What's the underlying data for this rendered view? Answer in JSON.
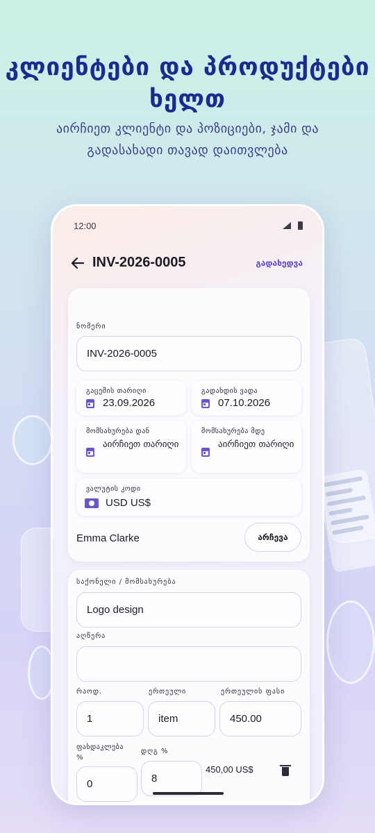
{
  "hero": {
    "title": "კლიენტები და პროდუქტები ხელთ",
    "subtitle": "აირჩიეთ კლიენტი და პოზიციები, ჯამი და გადასახადი თავად დაითვლება"
  },
  "status_bar": {
    "time": "12:00"
  },
  "header": {
    "title": "INV-2026-0005",
    "preview_label": "გადახედვა"
  },
  "invoice": {
    "number_label": "ნომერი",
    "number_value": "INV-2026-0005",
    "issue_date_label": "გაცემის თარიღი",
    "issue_date_value": "23.09.2026",
    "due_date_label": "გადახდის ვადა",
    "due_date_value": "07.10.2026",
    "service_from_label": "მომსახურება დან",
    "service_from_value": "აირჩიეთ თარიღი",
    "service_to_label": "მომსახურება მდე",
    "service_to_value": "აირჩიეთ თარიღი",
    "currency_label": "ვალუტის კოდი",
    "currency_value": "USD  US$",
    "client_name": "Emma Clarke",
    "choose_client_label": "არჩევა"
  },
  "line_item": {
    "product_label": "საქონელი / მომსახურება",
    "product_value": "Logo design",
    "description_label": "აღწერა",
    "description_value": "",
    "qty_label": "რაოდ.",
    "qty_value": "1",
    "unit_label": "ერთეული",
    "unit_value": "item",
    "unit_price_label": "ერთეულის ფასი",
    "unit_price_value": "450.00",
    "discount_label": "ფასდაკლება %",
    "discount_value": "0",
    "vat_label": "დღგ %",
    "vat_value": "8",
    "total_value": "450,00 US$"
  },
  "colors": {
    "accent": "#5b48c4",
    "hero_text": "#1c2a8f"
  }
}
